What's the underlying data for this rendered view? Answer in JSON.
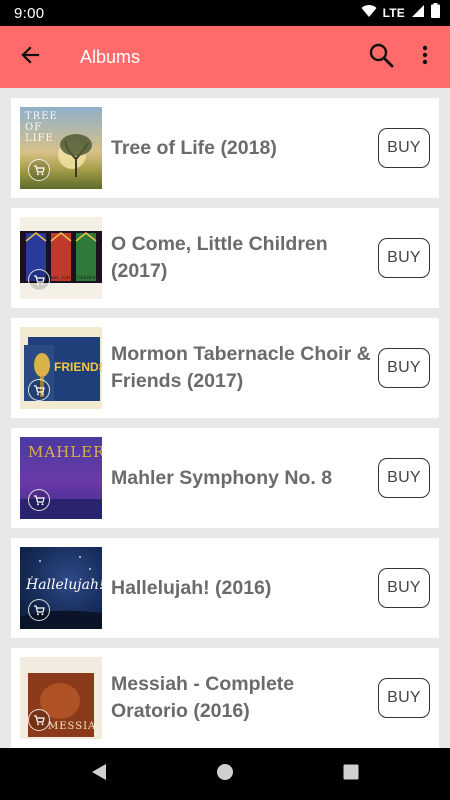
{
  "status_bar": {
    "time": "9:00",
    "network": "LTE"
  },
  "app_bar": {
    "title": "Albums"
  },
  "albums": [
    {
      "title": "Tree of Life (2018)",
      "buy_label": "BUY",
      "cover_text": "TREE OF LIFE"
    },
    {
      "title": "O Come, Little Children (2017)",
      "buy_label": "BUY",
      "cover_text": "O Come, Little Children"
    },
    {
      "title": "Mormon Tabernacle Choir & Friends (2017)",
      "buy_label": "BUY",
      "cover_text": "FRIENDS"
    },
    {
      "title": "Mahler Symphony No. 8",
      "buy_label": "BUY",
      "cover_text": "MAHLER"
    },
    {
      "title": "Hallelujah! (2016)",
      "buy_label": "BUY",
      "cover_text": "Hallelujah!"
    },
    {
      "title": "Messiah - Complete Oratorio (2016)",
      "buy_label": "BUY",
      "cover_text": "MESSIAH"
    }
  ],
  "colors": {
    "app_bar": "#ff6b6b",
    "background": "#e8e8e8",
    "title_text": "#6b6b6b"
  },
  "icons": [
    "back-arrow-icon",
    "search-icon",
    "more-vert-icon",
    "cart-icon",
    "nav-back-icon",
    "nav-home-icon",
    "nav-recents-icon"
  ]
}
